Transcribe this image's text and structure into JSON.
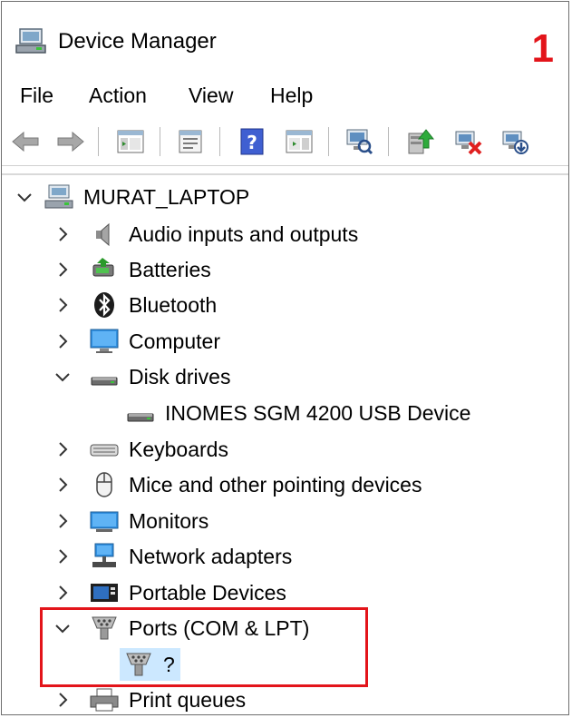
{
  "window": {
    "title": "Device Manager",
    "annotation_number": "1"
  },
  "menu": [
    "File",
    "Action",
    "View",
    "Help"
  ],
  "toolbar": {
    "icons": [
      "back-arrow-icon",
      "forward-arrow-icon",
      "show-hide-console-tree-icon",
      "properties-icon",
      "help-icon",
      "show-action-pane-icon",
      "scan-hardware-icon",
      "update-driver-icon",
      "disable-device-icon",
      "uninstall-device-icon"
    ]
  },
  "tree": {
    "root": "MURAT_LAPTOP",
    "items": [
      {
        "label": "Audio inputs and outputs",
        "expanded": false
      },
      {
        "label": "Batteries",
        "expanded": false
      },
      {
        "label": "Bluetooth",
        "expanded": false
      },
      {
        "label": "Computer",
        "expanded": false
      },
      {
        "label": "Disk drives",
        "expanded": true,
        "child": "INOMES SGM 4200 USB Device"
      },
      {
        "label": "Keyboards",
        "expanded": false
      },
      {
        "label": "Mice and other pointing devices",
        "expanded": false
      },
      {
        "label": "Monitors",
        "expanded": false
      },
      {
        "label": "Network adapters",
        "expanded": false
      },
      {
        "label": "Portable Devices",
        "expanded": false
      },
      {
        "label": "Ports (COM & LPT)",
        "expanded": true,
        "child": "?"
      },
      {
        "label": "Print queues",
        "expanded": false
      }
    ]
  },
  "colors": {
    "annotation_red": "#e3141a",
    "selection_blue": "#cce8ff"
  }
}
